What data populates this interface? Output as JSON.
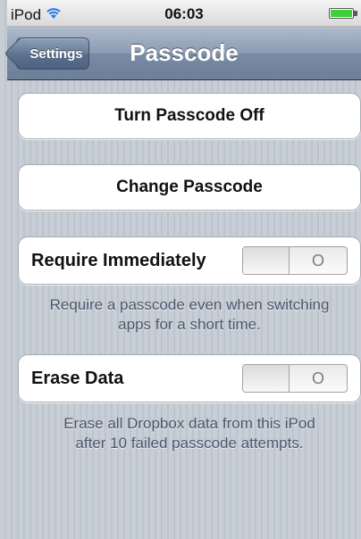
{
  "status_bar": {
    "carrier": "iPod",
    "wifi_icon": "wifi-icon",
    "time": "06:03",
    "battery_level": 1.0,
    "battery_icon": "battery-icon"
  },
  "nav_bar": {
    "title": "Passcode",
    "back_label": "Settings"
  },
  "cells": {
    "turn_off_label": "Turn Passcode Off",
    "change_label": "Change Passcode",
    "require_immediately": {
      "label": "Require Immediately",
      "state_label": "O",
      "on": false
    },
    "require_footer_line1": "Require a passcode even when switching",
    "require_footer_line2": "apps for a short time.",
    "erase_data": {
      "label": "Erase Data",
      "state_label": "O",
      "on": false
    },
    "erase_footer_line1": "Erase all Dropbox data from this iPod",
    "erase_footer_line2": "after 10 failed passcode attempts."
  },
  "colors": {
    "navbar": "#7a8ca5",
    "battery": "#3fcf3a",
    "footer_text": "#4c566c"
  }
}
